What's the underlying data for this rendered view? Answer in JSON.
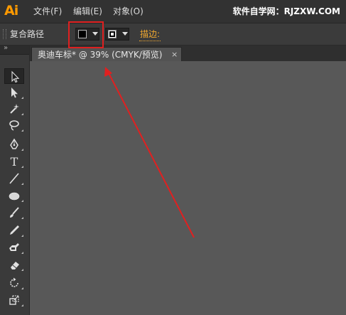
{
  "app": {
    "logo": "Ai"
  },
  "menu": {
    "items": [
      {
        "label": "文件(F)"
      },
      {
        "label": "编辑(E)"
      },
      {
        "label": "对象(O)"
      }
    ]
  },
  "watermark": "软件自学网：RJZXW.COM",
  "control_bar": {
    "selection_label": "复合路径",
    "fill_color": "#000000",
    "stroke_label": "描边:"
  },
  "document": {
    "tab_title": "奥迪车标* @ 39% (CMYK/预览)",
    "close_glyph": "×"
  },
  "tools": [
    {
      "name": "selection-tool-icon",
      "active": true
    },
    {
      "name": "direct-selection-tool-icon"
    },
    {
      "name": "magic-wand-tool-icon"
    },
    {
      "name": "lasso-tool-icon"
    },
    {
      "name": "pen-tool-icon"
    },
    {
      "name": "type-tool-icon",
      "glyph": "T"
    },
    {
      "name": "line-segment-tool-icon"
    },
    {
      "name": "ellipse-tool-icon"
    },
    {
      "name": "paintbrush-tool-icon"
    },
    {
      "name": "pencil-tool-icon"
    },
    {
      "name": "blob-brush-tool-icon"
    },
    {
      "name": "eraser-tool-icon"
    },
    {
      "name": "rotate-tool-icon"
    },
    {
      "name": "scale-tool-icon"
    }
  ],
  "colors": {
    "accent_orange": "#ff9a00",
    "annotation_red": "#e02020",
    "stroke_label": "#f0a830"
  }
}
